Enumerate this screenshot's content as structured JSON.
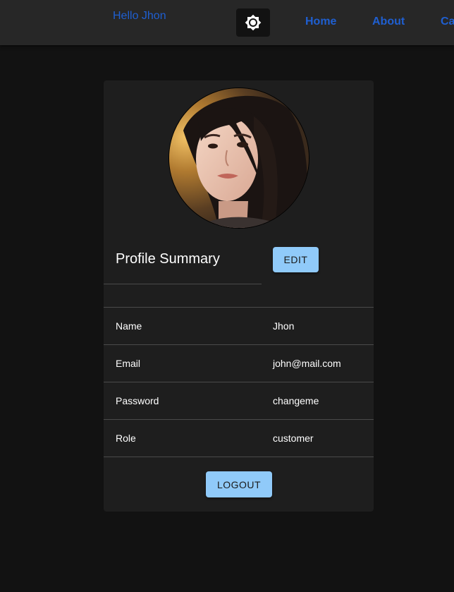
{
  "header": {
    "greeting": "Hello Jhon",
    "theme_toggle_icon": "sun-icon",
    "nav": [
      {
        "label": "Home"
      },
      {
        "label": "About"
      },
      {
        "label": "Ca"
      }
    ]
  },
  "profile": {
    "title": "Profile Summary",
    "edit_label": "EDIT",
    "logout_label": "LOGOUT",
    "rows": [
      {
        "key": "Name",
        "value": "Jhon"
      },
      {
        "key": "Email",
        "value": "john@mail.com"
      },
      {
        "key": "Password",
        "value": "changeme"
      },
      {
        "key": "Role",
        "value": "customer"
      }
    ]
  },
  "colors": {
    "accent": "#90caf9",
    "link": "#1f5fd1",
    "background": "#121212",
    "surface": "#1e1e1e",
    "appbar": "#272727"
  }
}
